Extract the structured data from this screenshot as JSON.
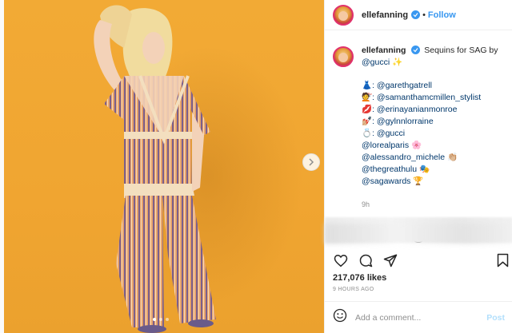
{
  "post": {
    "username": "ellefanning",
    "follow_label": "Follow",
    "separator": "•",
    "caption_text": "Sequins for SAG by",
    "caption_brand": "@gucci",
    "caption_brand_emoji": "✨",
    "credits": [
      "👗: @garethgatrell",
      "💇: @samanthamcmillen_stylist",
      "💋: @erinayanianmonroe",
      "💅🏼: @gylnnlorraine",
      "💍: @gucci",
      "@lorealparis 🌸",
      "@alessandro_michele 👏🏼",
      "@thegreathulu 🎭",
      "@sagawards 🏆"
    ],
    "time": "9h",
    "likes": "217,076 likes",
    "time_ago": "9 HOURS AGO",
    "add_comment_placeholder": "Add a comment...",
    "post_label": "Post"
  },
  "icons": {
    "verified": "verified-badge-icon",
    "heart": "heart-icon",
    "comment": "comment-icon",
    "share": "share-icon",
    "save": "bookmark-icon",
    "next": "chevron-right-icon",
    "more_comments": "plus-circle-icon",
    "emoji": "smiley-icon"
  },
  "colors": {
    "accent": "#3897f0",
    "photo_bg": "#f2aa35",
    "link": "#00376b",
    "muted": "#8e8e8e"
  },
  "carousel": {
    "count": 3,
    "active": 0
  }
}
